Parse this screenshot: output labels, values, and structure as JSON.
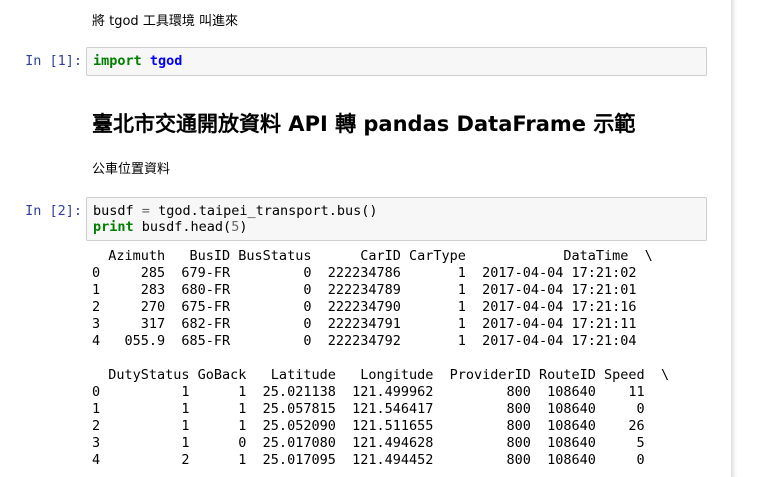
{
  "markdown": {
    "intro": "將 tgod 工具環境 叫進來",
    "heading": "臺北市交通開放資料 API 轉 pandas DataFrame 示範",
    "subtext": "公車位置資料"
  },
  "cells": [
    {
      "prompt": "In [1]:",
      "code": {
        "keyword": "import",
        "module": "tgod"
      }
    },
    {
      "prompt": "In [2]:",
      "code": {
        "line1": {
          "var": "busdf",
          "op": "=",
          "expr": "tgod.taipei_transport.bus()"
        },
        "line2": {
          "keyword": "print",
          "expr": "busdf.head(",
          "arg": "5",
          "close": ")"
        }
      }
    }
  ],
  "output": {
    "table1": {
      "header": "  Azimuth   BusID BusStatus      CarID CarType            DataTime  \\",
      "rows": [
        "0     285  679-FR         0  222234786       1  2017-04-04 17:21:02",
        "1     283  680-FR         0  222234789       1  2017-04-04 17:21:01",
        "2     270  675-FR         0  222234790       1  2017-04-04 17:21:16",
        "3     317  682-FR         0  222234791       1  2017-04-04 17:21:11",
        "4   055.9  685-FR         0  222234792       1  2017-04-04 17:21:04"
      ]
    },
    "table2": {
      "header": "  DutyStatus GoBack   Latitude   Longitude  ProviderID RouteID Speed  \\",
      "rows": [
        "0          1      1  25.021138  121.499962         800  108640    11",
        "1          1      1  25.057815  121.546417         800  108640     0",
        "2          1      1  25.052090  121.511655         800  108640    26",
        "3          1      0  25.017080  121.494628         800  108640     5",
        "4          2      1  25.017095  121.494452         800  108640     0"
      ]
    }
  }
}
